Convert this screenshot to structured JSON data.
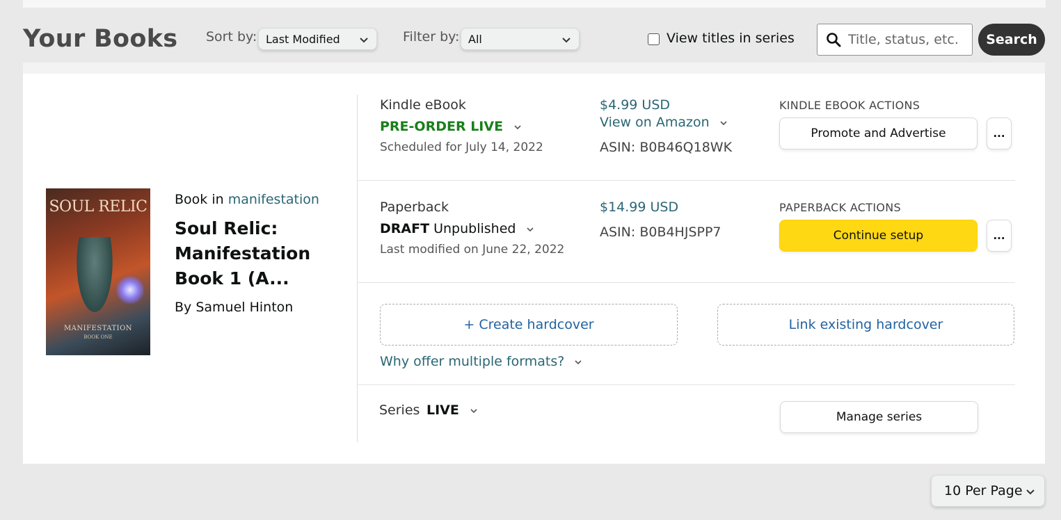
{
  "header": {
    "title": "Your Books",
    "sort_label": "Sort by:",
    "sort_value": "Last Modified",
    "filter_label": "Filter by:",
    "filter_value": "All",
    "series_checkbox_label": "View titles in series",
    "search_placeholder": "Title, status, etc.",
    "search_button": "Search"
  },
  "book": {
    "book_in_prefix": "Book in",
    "series_link": "manifestation",
    "title": "Soul Relic: Manifestation Book 1 (A...",
    "author": "By Samuel Hinton",
    "cover": {
      "title": "SOUL RELIC",
      "subtitle": "MANIFESTATION",
      "subtitle2": "BOOK ONE"
    }
  },
  "formats": {
    "ebook": {
      "name": "Kindle eBook",
      "status": "PRE-ORDER LIVE",
      "sub": "Scheduled for July 14, 2022",
      "price": "$4.99 USD",
      "view_link": "View on Amazon",
      "asin": "ASIN: B0B46Q18WK",
      "actions_label": "KINDLE EBOOK ACTIONS",
      "primary_action": "Promote and Advertise",
      "more": "..."
    },
    "paperback": {
      "name": "Paperback",
      "status_bold": "DRAFT",
      "status_rest": "Unpublished",
      "sub": "Last modified on June 22, 2022",
      "price": "$14.99 USD",
      "asin": "ASIN: B0B4HJSPP7",
      "actions_label": "PAPERBACK ACTIONS",
      "primary_action": "Continue setup",
      "more": "..."
    },
    "hardcover": {
      "create": "+ Create hardcover",
      "link_existing": "Link existing hardcover",
      "why": "Why offer multiple formats?"
    },
    "series": {
      "label": "Series",
      "status": "LIVE",
      "action": "Manage series"
    }
  },
  "pagination": {
    "per_page": "10 Per Page"
  },
  "colors": {
    "live_green": "#1a7f1a",
    "link_teal": "#2a6674",
    "link_blue": "#2162a1",
    "primary_yellow": "#ffd814",
    "search_dark": "#333333"
  }
}
